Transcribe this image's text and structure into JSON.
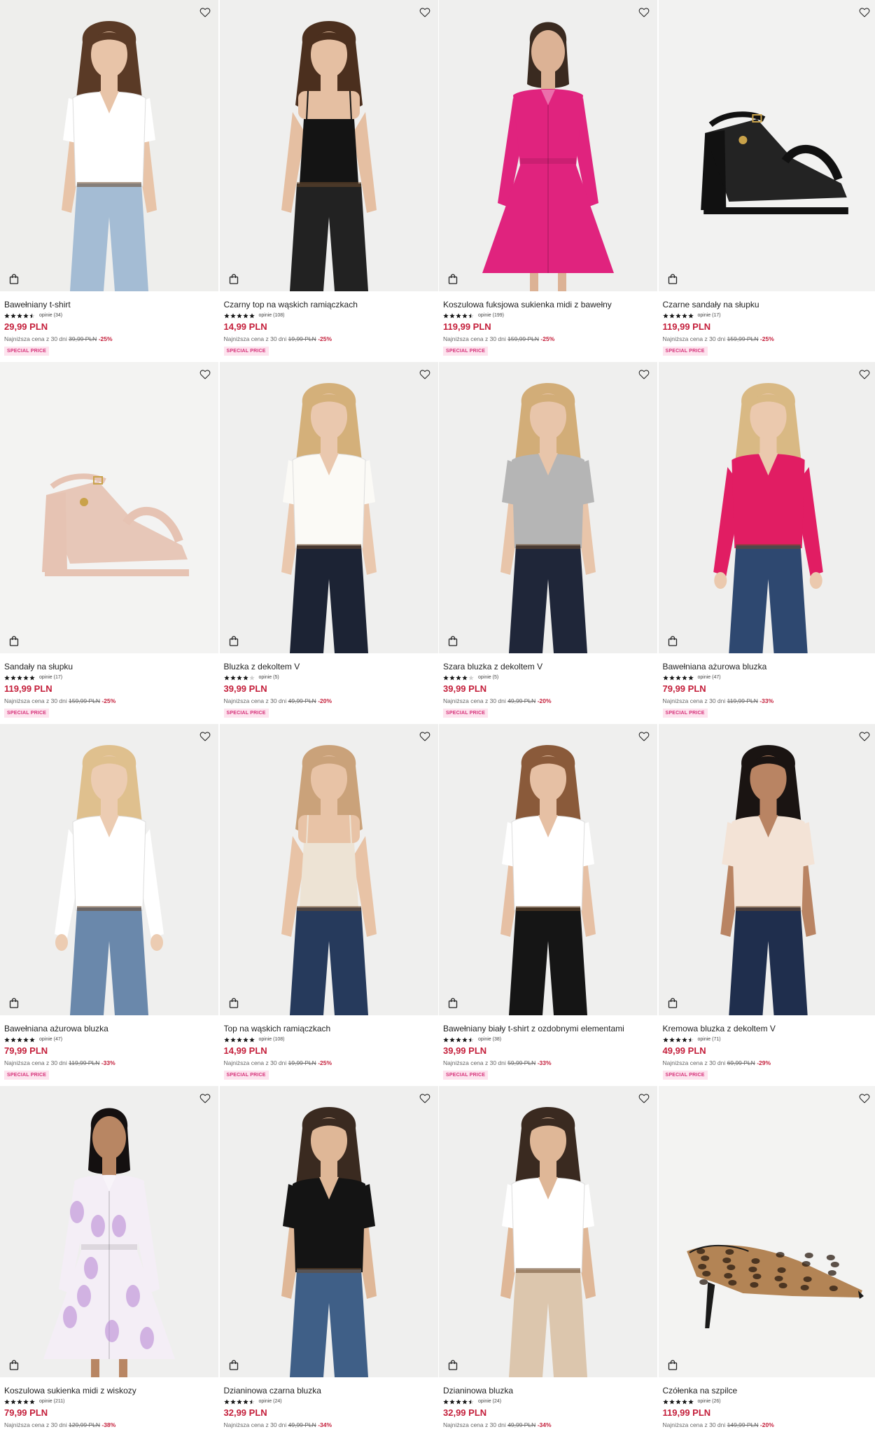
{
  "labels": {
    "special": "SPECIAL PRICE",
    "lowest_prefix": "Najniższa cena z 30 dni",
    "reviews_prefix": "opinie"
  },
  "colors": {
    "price": "#c41e3a",
    "badge_bg": "#fde3ee",
    "badge_text": "#d6337a"
  },
  "icons": {
    "favorite": "heart-icon",
    "cart": "shopping-bag-icon",
    "rating": "star-icon"
  },
  "products": [
    {
      "name": "Bawełniany t-shirt",
      "rating": 4.5,
      "reviews": "opinie (34)",
      "price": "29,99 PLN",
      "old_price": "39,99 PLN",
      "discount": "-25%",
      "badge": "SPECIAL PRICE",
      "kind": "person",
      "bg": "#eeeeec",
      "top": "#ffffff",
      "bottom": "#a4bcd4",
      "hair": "#5a3a26",
      "skin": "#e8c4a8",
      "sleeve": "short"
    },
    {
      "name": "Czarny top na wąskich ramiączkach",
      "rating": 5,
      "reviews": "opinie (108)",
      "price": "14,99 PLN",
      "old_price": "19,99 PLN",
      "discount": "-25%",
      "badge": "SPECIAL PRICE",
      "kind": "person",
      "bg": "#efefee",
      "top": "#141414",
      "bottom": "#222222",
      "hair": "#4b2f1e",
      "skin": "#e5bfa2",
      "sleeve": "none"
    },
    {
      "name": "Koszulowa fuksjowa sukienka midi z bawełny",
      "rating": 4.5,
      "reviews": "opinie (199)",
      "price": "119,99 PLN",
      "old_price": "159,99 PLN",
      "discount": "-25%",
      "badge": "SPECIAL PRICE",
      "kind": "dress",
      "bg": "#efefee",
      "top": "#e0237e",
      "bottom": "#e0237e",
      "hair": "#3a2a20",
      "skin": "#dcb295",
      "sleeve": "long"
    },
    {
      "name": "Czarne sandały na słupku",
      "rating": 5,
      "reviews": "opinie (17)",
      "price": "119,99 PLN",
      "old_price": "159,99 PLN",
      "discount": "-25%",
      "badge": "SPECIAL PRICE",
      "kind": "sandal",
      "bg": "#f2f2f1",
      "top": "#111111",
      "bottom": "#111111",
      "hair": "",
      "skin": "",
      "sleeve": ""
    },
    {
      "name": "Sandały na słupku",
      "rating": 5,
      "reviews": "opinie (17)",
      "price": "119,99 PLN",
      "old_price": "159,99 PLN",
      "discount": "-25%",
      "badge": "SPECIAL PRICE",
      "kind": "sandal",
      "bg": "#f3f3f2",
      "top": "#e6c3b3",
      "bottom": "#e6c3b3",
      "hair": "",
      "skin": "",
      "sleeve": ""
    },
    {
      "name": "Bluzka z dekoltem V",
      "rating": 4,
      "reviews": "opinie (5)",
      "price": "39,99 PLN",
      "old_price": "49,99 PLN",
      "discount": "-20%",
      "badge": "SPECIAL PRICE",
      "kind": "person",
      "bg": "#efefee",
      "top": "#fbfaf6",
      "bottom": "#1c2334",
      "hair": "#d4b07a",
      "skin": "#eac8ae",
      "sleeve": "short"
    },
    {
      "name": "Szara bluzka z dekoltem V",
      "rating": 4,
      "reviews": "opinie (5)",
      "price": "39,99 PLN",
      "old_price": "49,99 PLN",
      "discount": "-20%",
      "badge": "SPECIAL PRICE",
      "kind": "person",
      "bg": "#efefee",
      "top": "#b5b5b5",
      "bottom": "#1f2639",
      "hair": "#d2ad78",
      "skin": "#e8c5aa",
      "sleeve": "short"
    },
    {
      "name": "Bawełniana ażurowa bluzka",
      "rating": 5,
      "reviews": "opinie (47)",
      "price": "79,99 PLN",
      "old_price": "119,99 PLN",
      "discount": "-33%",
      "badge": "SPECIAL PRICE",
      "kind": "person",
      "bg": "#efefee",
      "top": "#e11d63",
      "bottom": "#2e4870",
      "hair": "#d9b984",
      "skin": "#ebc9ae",
      "sleeve": "long"
    },
    {
      "name": "Bawełniana ażurowa bluzka",
      "rating": 5,
      "reviews": "opinie (47)",
      "price": "79,99 PLN",
      "old_price": "119,99 PLN",
      "discount": "-33%",
      "badge": "SPECIAL PRICE",
      "kind": "person",
      "bg": "#efefee",
      "top": "#ffffff",
      "bottom": "#6a88ab",
      "hair": "#dfc08e",
      "skin": "#ecccb2",
      "sleeve": "long"
    },
    {
      "name": "Top na wąskich ramiączkach",
      "rating": 5,
      "reviews": "opinie (108)",
      "price": "14,99 PLN",
      "old_price": "19,99 PLN",
      "discount": "-25%",
      "badge": "SPECIAL PRICE",
      "kind": "person",
      "bg": "#efefee",
      "top": "#ede3d4",
      "bottom": "#263a5c",
      "hair": "#caa27a",
      "skin": "#e8c3a6",
      "sleeve": "none"
    },
    {
      "name": "Bawełniany biały t-shirt z ozdobnymi elementami",
      "rating": 4.5,
      "reviews": "opinie (38)",
      "price": "39,99 PLN",
      "old_price": "59,99 PLN",
      "discount": "-33%",
      "badge": "SPECIAL PRICE",
      "kind": "person",
      "bg": "#efefee",
      "top": "#ffffff",
      "bottom": "#151515",
      "hair": "#8a5a3a",
      "skin": "#e6c0a4",
      "sleeve": "short"
    },
    {
      "name": "Kremowa bluzka z dekoltem V",
      "rating": 4.5,
      "reviews": "opinie (71)",
      "price": "49,99 PLN",
      "old_price": "69,99 PLN",
      "discount": "-29%",
      "badge": "SPECIAL PRICE",
      "kind": "person",
      "bg": "#efefee",
      "top": "#f3e3d6",
      "bottom": "#1f2e4d",
      "hair": "#1a1412",
      "skin": "#b98463",
      "sleeve": "short"
    },
    {
      "name": "Koszulowa sukienka midi z wiskozy",
      "rating": 5,
      "reviews": "opinie (211)",
      "price": "79,99 PLN",
      "old_price": "129,99 PLN",
      "discount": "-38%",
      "badge": "",
      "kind": "dress",
      "bg": "#efefee",
      "top": "#f4eef6",
      "bottom": "#f4eef6",
      "hair": "#141010",
      "skin": "#b88663",
      "sleeve": "long"
    },
    {
      "name": "Dzianinowa czarna bluzka",
      "rating": 4.5,
      "reviews": "opinie (24)",
      "price": "32,99 PLN",
      "old_price": "49,99 PLN",
      "discount": "-34%",
      "badge": "",
      "kind": "person",
      "bg": "#efefee",
      "top": "#141414",
      "bottom": "#3f5f87",
      "hair": "#3a2a20",
      "skin": "#dfb797",
      "sleeve": "short"
    },
    {
      "name": "Dzianinowa bluzka",
      "rating": 4.5,
      "reviews": "opinie (24)",
      "price": "32,99 PLN",
      "old_price": "49,99 PLN",
      "discount": "-34%",
      "badge": "",
      "kind": "person",
      "bg": "#efefee",
      "top": "#ffffff",
      "bottom": "#dcc6ad",
      "hair": "#3a2a20",
      "skin": "#dfb797",
      "sleeve": "short"
    },
    {
      "name": "Czółenka na szpilce",
      "rating": 5,
      "reviews": "opinie (26)",
      "price": "119,99 PLN",
      "old_price": "149,99 PLN",
      "discount": "-20%",
      "badge": "",
      "kind": "heel",
      "bg": "#f3f3f2",
      "top": "#b38455",
      "bottom": "#1a1a1a",
      "hair": "",
      "skin": "",
      "sleeve": ""
    }
  ]
}
